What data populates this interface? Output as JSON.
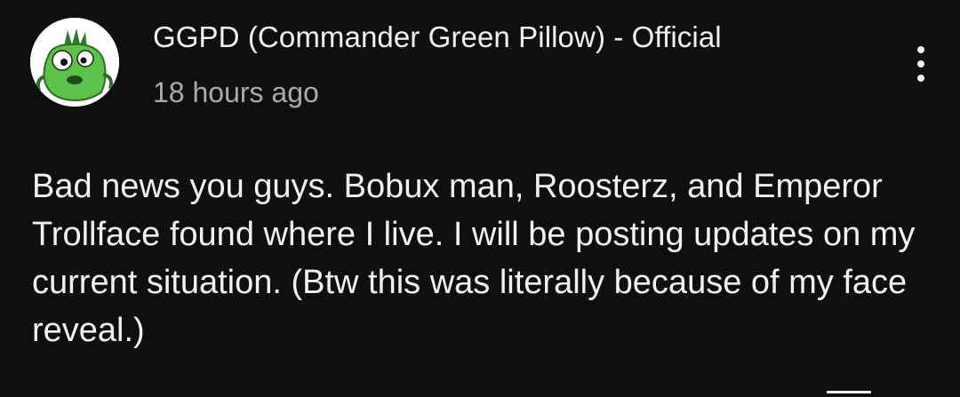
{
  "comment": {
    "author": "GGPD (Commander Green Pillow) - Official",
    "timestamp": "18 hours ago",
    "text": "Bad news you guys. Bobux man, Roosterz, and Emperor Trollface found where I live. I will be posting updates on my current situation. (Btw this was literally because of my face reveal.)",
    "avatar_icon": "green-pillow-character-avatar",
    "menu_icon": "more-vertical-icon"
  },
  "colors": {
    "background": "#0f0f0f",
    "primary_text": "#f1f1f1",
    "secondary_text": "#aaaaaa",
    "avatar_green": "#5cc24a"
  }
}
